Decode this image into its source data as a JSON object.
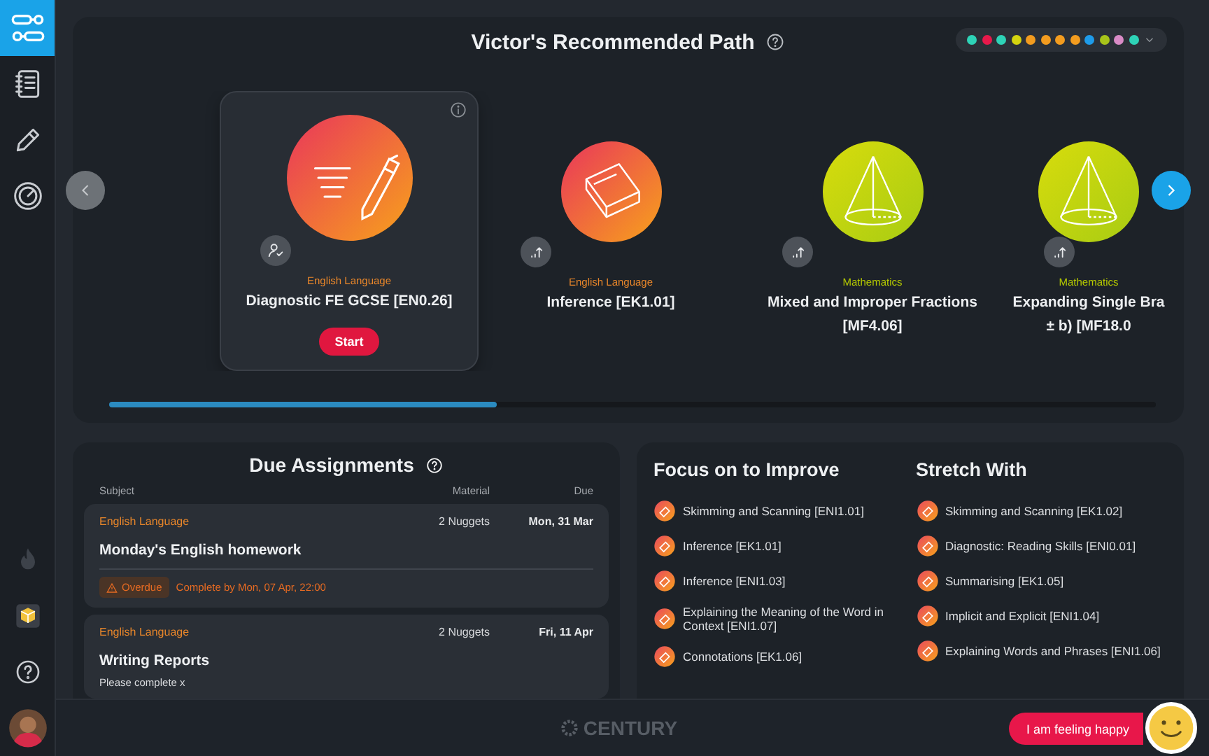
{
  "sidebar": {
    "items": [
      {
        "kind": "path",
        "selected": true
      },
      {
        "kind": "notebook",
        "selected": false
      },
      {
        "kind": "pencil",
        "selected": false
      },
      {
        "kind": "gauge",
        "selected": false
      }
    ],
    "bottom_items": [
      {
        "kind": "flame"
      },
      {
        "kind": "cube"
      },
      {
        "kind": "help"
      },
      {
        "kind": "avatar"
      }
    ]
  },
  "path_panel": {
    "title": "Victor's Recommended Path",
    "filter_dots": [
      {
        "color": "#2ed3b7"
      },
      {
        "color": "#e8194b"
      },
      {
        "color": "#2ed3b7"
      },
      {
        "color": "#d4d40f"
      },
      {
        "color": "#f39c1f"
      },
      {
        "color": "#f39c1f"
      },
      {
        "color": "#f39c1f"
      },
      {
        "color": "#f39c1f"
      },
      {
        "color": "#1e9be9"
      },
      {
        "color": "#a8c41a"
      },
      {
        "color": "#d98bc6"
      },
      {
        "color": "#2ed3b7"
      }
    ],
    "cards": [
      {
        "kind": "pen",
        "badge": {
          "kind": "person"
        },
        "selected": true,
        "color": "#e8862a",
        "subject": "English Language",
        "title_lines": [
          "Diagnostic FE GCSE [EN0.26]"
        ],
        "button": "Start"
      },
      {
        "kind": "book",
        "badge": {
          "kind": "chart"
        },
        "selected": false,
        "color": "#e8862a",
        "subject": "English Language",
        "title_lines": [
          "Inference [EK1.01]"
        ]
      },
      {
        "kind": "cone",
        "badge": {
          "kind": "chart"
        },
        "selected": false,
        "color": "#b5c900",
        "subject": "Mathematics",
        "title_lines": [
          "Mixed and Improper Fractions",
          "[MF4.06]"
        ]
      },
      {
        "kind": "cone",
        "badge": {
          "kind": "chart"
        },
        "selected": false,
        "color": "#b5c900",
        "subject": "Mathematics",
        "title_lines": [
          "Expanding Single Bra",
          "± b) [MF18.0"
        ]
      }
    ]
  },
  "due_assignments": {
    "title": "Due Assignments",
    "columns": [
      "Subject",
      "Material",
      "Due"
    ],
    "rows": [
      {
        "subject": "English Language",
        "material": "2 Nuggets",
        "due": "Mon, 31 Mar",
        "title": "Monday's English homework",
        "status": "Overdue",
        "deadline": "Complete by Mon, 07 Apr, 22:00"
      },
      {
        "subject": "English Language",
        "material": "2 Nuggets",
        "due": "Fri, 11 Apr",
        "title": "Writing Reports",
        "note": "Please complete x"
      }
    ]
  },
  "skills": [
    {
      "title": "Focus on to Improve",
      "items": [
        "Skimming and Scanning [ENI1.01]",
        "Inference [EK1.01]",
        "Inference [ENI1.03]",
        "Explaining the Meaning of the Word in Context [ENI1.07]",
        "Connotations [EK1.06]"
      ]
    },
    {
      "title": "Stretch With",
      "items": [
        "Skimming and Scanning [EK1.02]",
        "Diagnostic: Reading Skills [ENI0.01]",
        "Summarising [EK1.05]",
        "Implicit and Explicit [ENI1.04]",
        "Explaining Words and Phrases [ENI1.06]"
      ]
    }
  ],
  "footer": {
    "logo": "CENTURY",
    "mood_button": "I am feeling happy"
  }
}
